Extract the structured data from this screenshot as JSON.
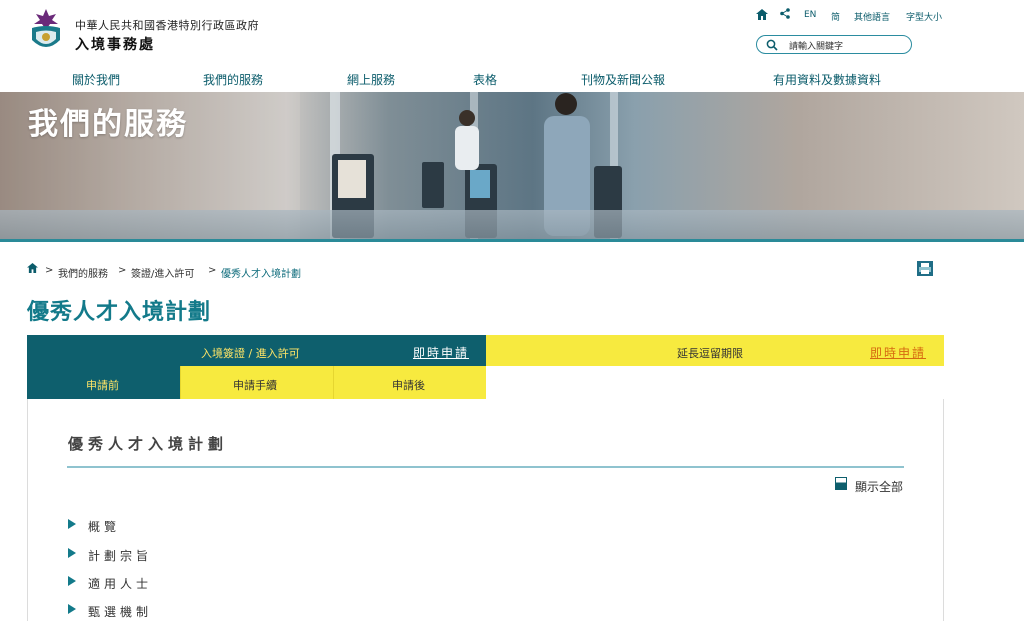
{
  "header": {
    "dept_name_line1": "中華人民共和國香港特別行政區政府",
    "dept_name_line2": "入境事務處",
    "utility": {
      "english": "EN",
      "simplified": "简",
      "other_languages": "其他語言",
      "font_size": "字型大小"
    },
    "search_placeholder": "請輸入關鍵字",
    "nav": [
      "關於我們",
      "我們的服務",
      "網上服務",
      "表格",
      "刊物及新聞公報",
      "有用資料及數據資料"
    ]
  },
  "banner": {
    "title": "我們的服務"
  },
  "breadcrumb": {
    "items": [
      "我們的服務",
      "簽證/進入許可",
      "優秀人才入境計劃"
    ],
    "separator": ">"
  },
  "page_title": "優秀人才入境計劃",
  "tabs": {
    "top_left": {
      "label": "入境簽證 / 進入許可",
      "link": "即時申請"
    },
    "top_right": {
      "label": "延長逗留期限",
      "link": "即時申請"
    },
    "sub": [
      "申請前",
      "申請手續",
      "申請後"
    ]
  },
  "content": {
    "title": "優秀人才入境計劃",
    "show_all": "顯示全部",
    "sections": [
      "概覽",
      "計劃宗旨",
      "適用人士",
      "甄選機制"
    ]
  },
  "colors": {
    "teal": "#0e5f6d",
    "yellow": "#f7ea3f",
    "accent_text": "#137a8a",
    "link_orange": "#d66a10"
  },
  "icons": [
    "hkid-emblem-icon",
    "home-icon",
    "share-icon",
    "search-icon",
    "print-icon",
    "caret-right-icon"
  ]
}
